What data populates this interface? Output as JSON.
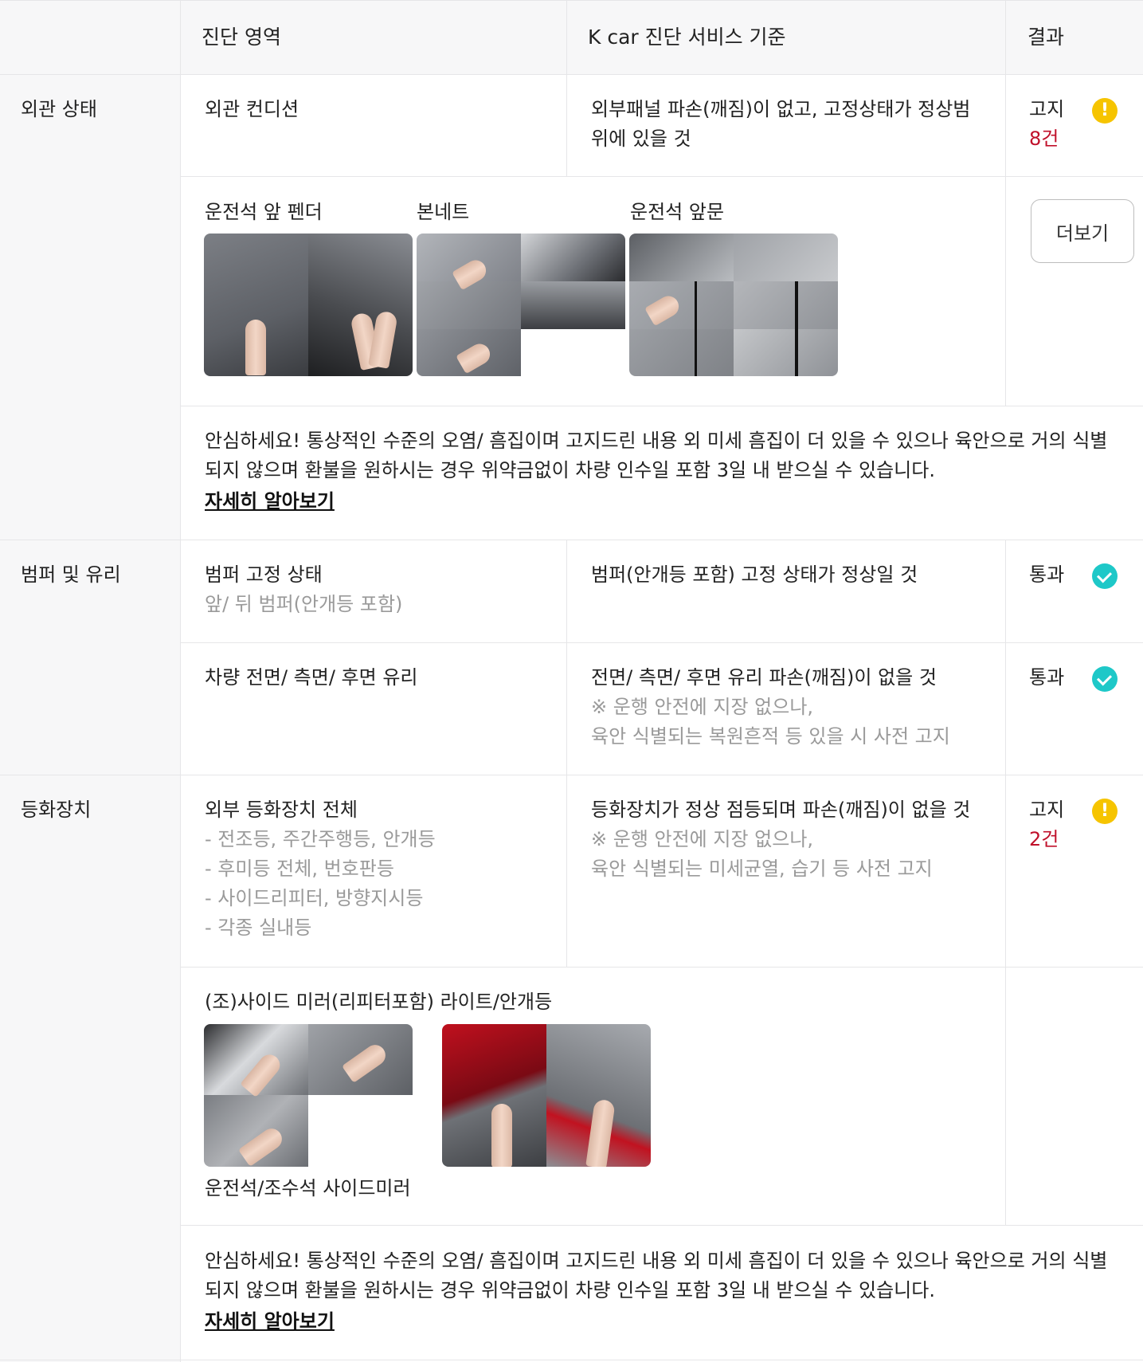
{
  "header": {
    "area": "진단 영역",
    "standard": "K car 진단 서비스 기준",
    "result": "결과"
  },
  "sections": {
    "exterior": {
      "title": "외관 상태",
      "item": "외관 컨디션",
      "standard_lines": [
        "외부패널 파손(깨짐)이 없고, 고정상태가 정상범",
        "위에 있을 것"
      ],
      "result_label": "고지",
      "result_count": "8건",
      "photos": [
        "운전석 앞 펜더",
        "본네트",
        "운전석 앞문"
      ],
      "more_label": "더보기",
      "notice_lines": [
        "안심하세요! 통상적인 수준의 오염/ 흠집이며 고지드린 내용 외 미세 흠집이 더 있을 수 있으나 육안으로 거의 식별",
        "되지 않으며 환불을 원하시는 경우 위약금없이 차량 인수일 포함 3일 내 받으실 수 있습니다."
      ],
      "detail_link": "자세히 알아보기"
    },
    "bumper": {
      "title": "범퍼 및 유리",
      "row1": {
        "item": "범퍼 고정 상태",
        "sub": "앞/ 뒤 범퍼(안개등 포함)",
        "standard": "범퍼(안개등 포함) 고정 상태가 정상일 것",
        "result": "통과"
      },
      "row2": {
        "item": "차량 전면/ 측면/ 후면 유리",
        "standard": "전면/ 측면/ 후면 유리 파손(깨짐)이 없을 것",
        "note1": "※ 운행 안전에 지장 없으나,",
        "note2": "육안 식별되는 복원흔적 등 있을 시 사전 고지",
        "result": "통과"
      }
    },
    "lights": {
      "title": "등화장치",
      "item": "외부 등화장치 전체",
      "subs": [
        "- 전조등, 주간주행등, 안개등",
        "- 후미등 전체, 번호판등",
        "- 사이드리피터, 방향지시등",
        "- 각종 실내등"
      ],
      "standard": "등화장치가 정상 점등되며 파손(깨짐)이 없을 것",
      "note1": "※ 운행 안전에 지장 없으나,",
      "note2": "육안 식별되는 미세균열, 습기 등 사전 고지",
      "result_label": "고지",
      "result_count": "2건",
      "photo_title": "(조)사이드 미러(리피터포함) 라이트/안개등",
      "photo_caption": "운전석/조수석 사이드미러",
      "notice_lines": [
        "안심하세요! 통상적인 수준의 오염/ 흠집이며 고지드린 내용 외 미세 흠집이 더 있을 수 있으나 육안으로 거의 식별",
        "되지 않으며 환불을 원하시는 경우 위약금없이 차량 인수일 포함 3일 내 받으실 수 있습니다."
      ],
      "detail_link": "자세히 알아보기"
    }
  },
  "colors": {
    "warn": "#f6c400",
    "pass": "#1ec8c8",
    "count": "#c0102a"
  },
  "icons": {
    "warn": "exclamation-icon",
    "pass": "check-icon"
  }
}
